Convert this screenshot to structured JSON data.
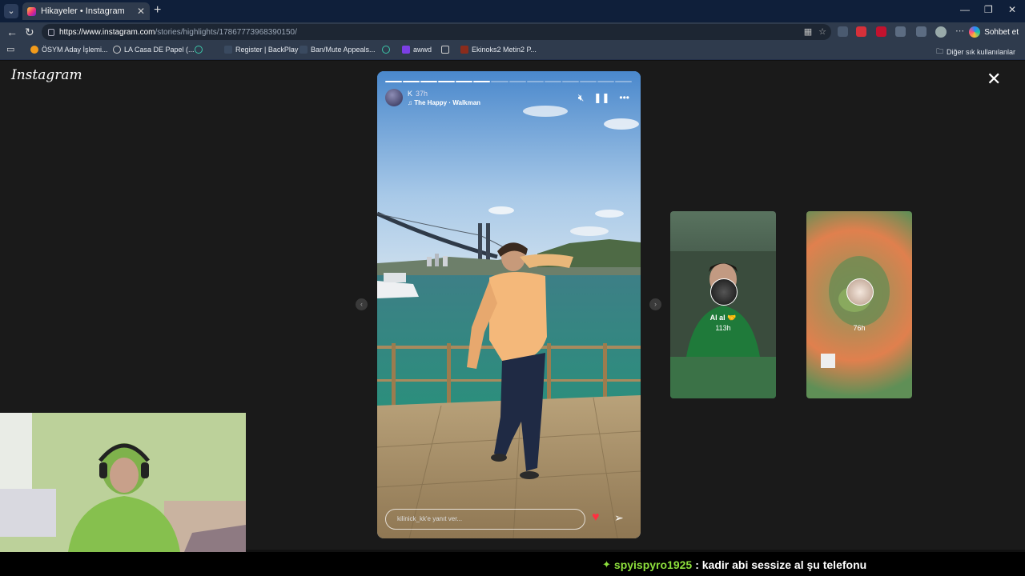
{
  "browser": {
    "tab_title": "Hikayeler • Instagram",
    "url_host": "https://www.instagram.com",
    "url_path": "/stories/highlights/17867773968390150/",
    "chat_label": "Sohbet et"
  },
  "bookmarks": [
    {
      "label": "ÖSYM Aday İşlemi..."
    },
    {
      "label": "LA Casa DE Papel (..."
    },
    {
      "label": ""
    },
    {
      "label": "Register | BackPlay"
    },
    {
      "label": "Ban/Mute Appeals..."
    },
    {
      "label": ""
    },
    {
      "label": "awwd"
    },
    {
      "label": ""
    },
    {
      "label": "Ekinoks2 Metin2 P..."
    }
  ],
  "bookmarks_other": "Diğer sık kullanılanlar",
  "instagram": {
    "logo": "Instagram",
    "story": {
      "user": "K",
      "time": "37h",
      "song": "The Happy · Walkman",
      "reply_placeholder": "kilinick_kk'e yanıt ver...",
      "progress": {
        "segments": 14,
        "done": 6
      }
    },
    "other_highlights": [
      {
        "name": "Al al 🤝",
        "time": "113h"
      },
      {
        "name": "",
        "time": "76h"
      }
    ]
  },
  "overlay": {
    "chat_user": "spyispyro1925",
    "chat_text": ": kadir abi sessize al şu telefonu"
  }
}
